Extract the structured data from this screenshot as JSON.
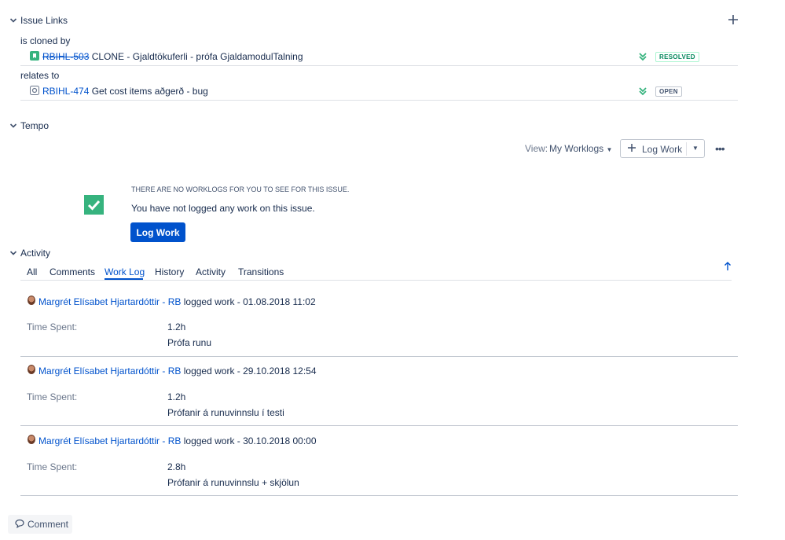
{
  "issue_links": {
    "title": "Issue Links",
    "add_icon": "plus-icon",
    "groups": [
      {
        "relation": "is cloned by",
        "key": "RBIHL-503",
        "summary": "CLONE - Gjaldtökuferli - prófa GjaldamodulTalning",
        "status": "RESOLVED",
        "status_color": "#00875a",
        "resolved": true
      },
      {
        "relation": "relates to",
        "key": "RBIHL-474",
        "summary": "Get cost items aðgerð - bug",
        "status": "OPEN",
        "status_color": "#42526e",
        "resolved": false
      }
    ]
  },
  "tempo": {
    "title": "Tempo",
    "view_label": "View:",
    "view_value": "My Worklogs",
    "log_work_label": "Log Work",
    "more_icon": "ellipsis-icon",
    "empty_heading": "THERE ARE NO WORKLOGS FOR YOU TO SEE FOR THIS ISSUE.",
    "empty_text": "You have not logged any work on this issue.",
    "empty_button": "Log Work"
  },
  "activity": {
    "title": "Activity",
    "tabs": [
      "All",
      "Comments",
      "Work Log",
      "History",
      "Activity",
      "Transitions"
    ],
    "active_tab": "Work Log",
    "entries": [
      {
        "author": "Margrét Elísabet Hjartardóttir - RB",
        "action": "logged work - 01.08.2018 11:02",
        "time_label": "Time Spent:",
        "time": "1.2h",
        "comment": "Prófa runu"
      },
      {
        "author": "Margrét Elísabet Hjartardóttir - RB",
        "action": "logged work - 29.10.2018 12:54",
        "time_label": "Time Spent:",
        "time": "1.2h",
        "comment": "Prófanir á runuvinnslu í testi"
      },
      {
        "author": "Margrét Elísabet Hjartardóttir - RB",
        "action": "logged work - 30.10.2018 00:00",
        "time_label": "Time Spent:",
        "time": "2.8h",
        "comment": "Prófanir á runuvinnslu + skjölun"
      }
    ]
  },
  "comment_button": "Comment",
  "colors": {
    "link": "#0052cc",
    "primary": "#0052cc",
    "success": "#36b37e",
    "text": "#172b4d"
  }
}
